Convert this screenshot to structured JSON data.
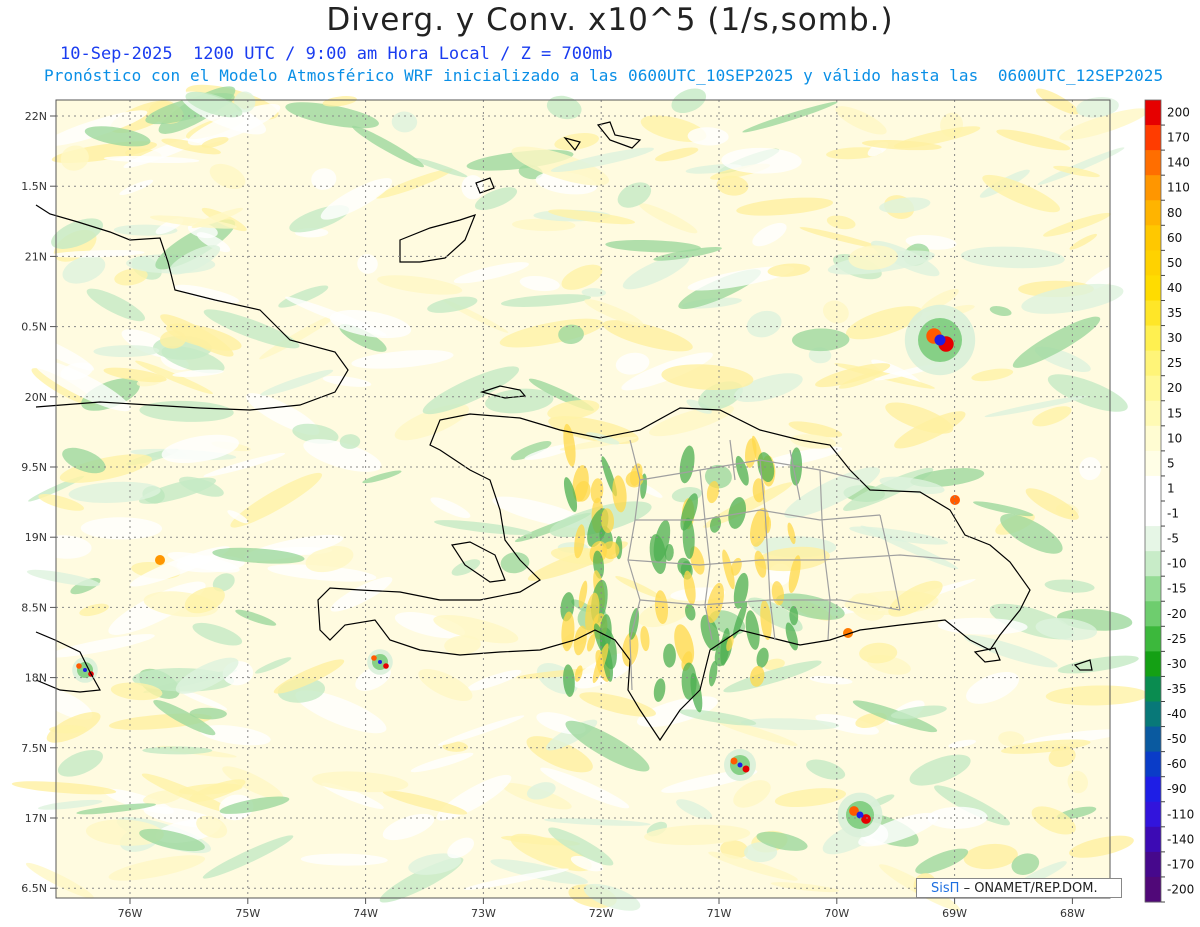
{
  "title": "Diverg. y Conv. x10^5 (1/s,somb.)",
  "subtitle_line1": "10-Sep-2025  1200 UTC / 9:00 am Hora Local / Z = 700mb",
  "subtitle_line2": "Pronóstico con el Modelo Atmosférico WRF inicializado a las 0600UTC_10SEP2025 y válido hasta las  0600UTC_12SEP2025",
  "credit": {
    "brand": "SisΠ",
    "text": "– ONAMET/REP.DOM."
  },
  "map": {
    "lat_labels": [
      "22N",
      "1.5N",
      "21N",
      "0.5N",
      "20N",
      "9.5N",
      "19N",
      "8.5N",
      "18N",
      "7.5N",
      "17N",
      "6.5N"
    ],
    "lon_labels": [
      "76W",
      "75W",
      "74W",
      "73W",
      "72W",
      "71W",
      "70W",
      "69W",
      "68W"
    ]
  },
  "colorbar": {
    "labels": [
      "200",
      "170",
      "140",
      "110",
      "80",
      "60",
      "50",
      "40",
      "35",
      "30",
      "25",
      "20",
      "15",
      "10",
      "5",
      "1",
      "-1",
      "-5",
      "-10",
      "-15",
      "-20",
      "-25",
      "-30",
      "-35",
      "-40",
      "-50",
      "-60",
      "-90",
      "-110",
      "-140",
      "-170",
      "-200"
    ],
    "colors": [
      "#e60000",
      "#ff3c00",
      "#ff6e00",
      "#ff9600",
      "#ffb400",
      "#ffc800",
      "#ffd200",
      "#ffdc00",
      "#ffe628",
      "#fff050",
      "#fff478",
      "#fff896",
      "#fffab4",
      "#fffcd2",
      "#fffee6",
      "#ffffff",
      "#ffffff",
      "#e6f6e6",
      "#c8ecc8",
      "#96dc96",
      "#6ecd6e",
      "#3cb83c",
      "#14a014",
      "#0a8c50",
      "#087878",
      "#0a5aa0",
      "#0a3cc8",
      "#1e1ee6",
      "#3214dc",
      "#3c0ab4",
      "#46088c",
      "#500878"
    ]
  },
  "colors": {
    "coast": "#000000",
    "provinces": "#a0a0a0",
    "convergence": "#2a9a2a",
    "divergence": "#ffe65a"
  }
}
